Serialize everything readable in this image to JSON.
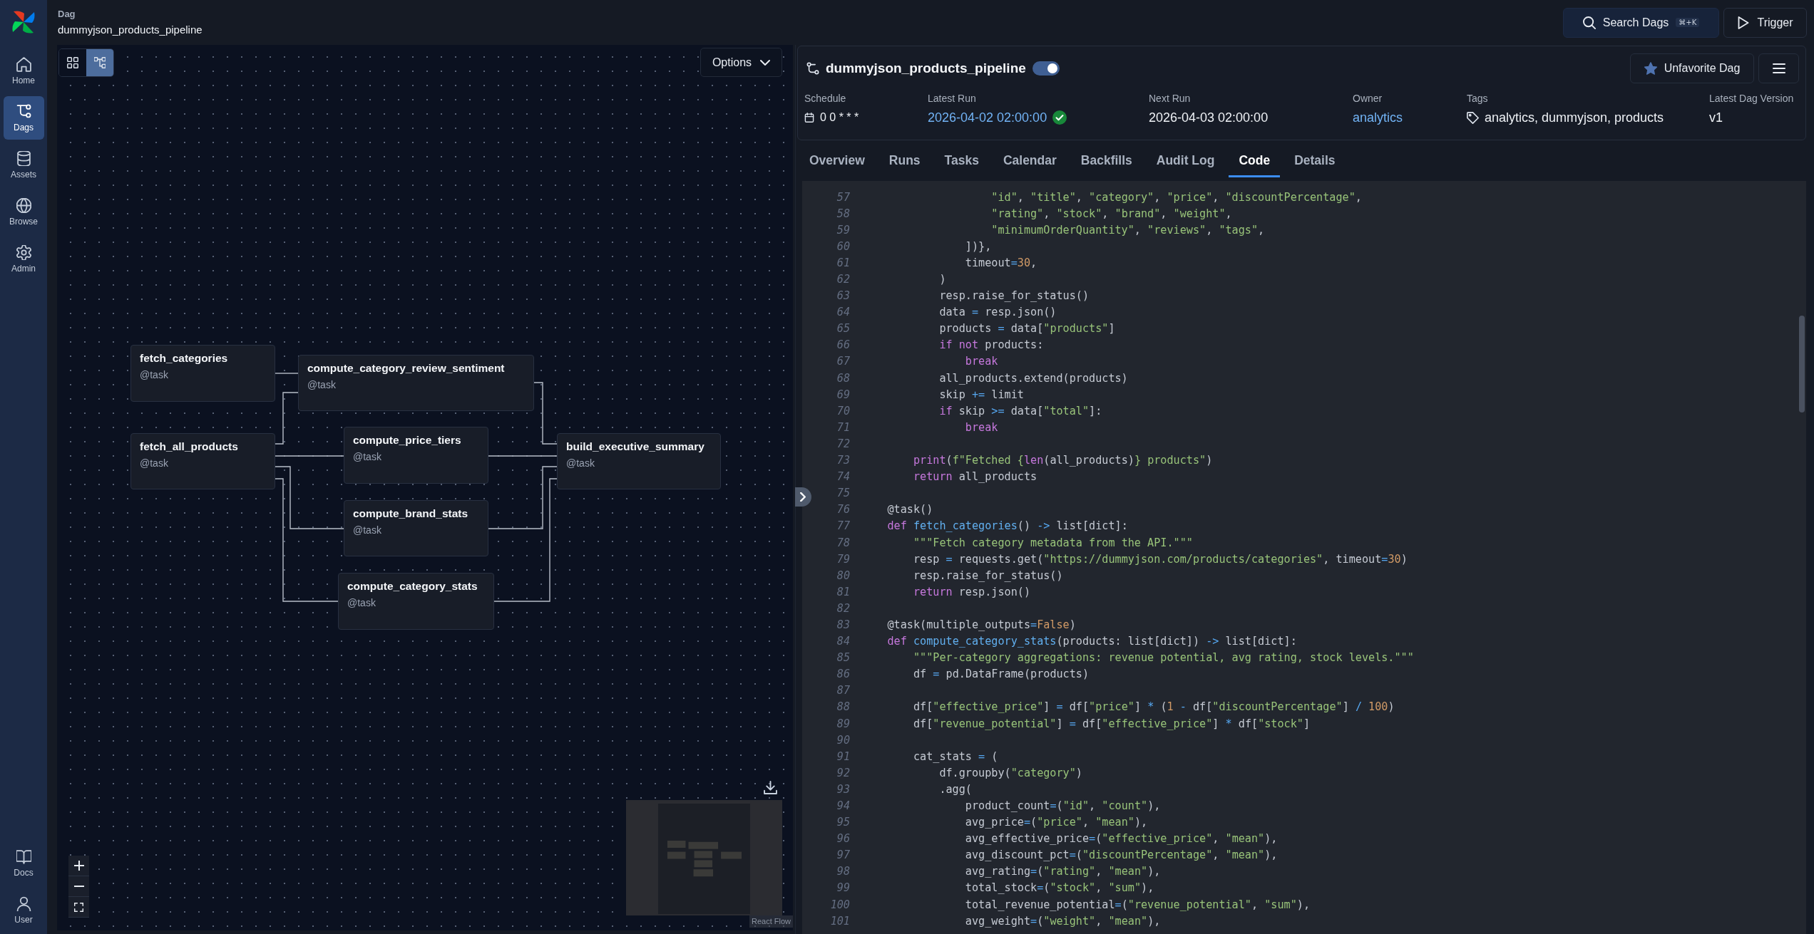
{
  "sidebar": {
    "items": [
      {
        "kind": "home",
        "label": "Home",
        "selected": false
      },
      {
        "kind": "dags",
        "label": "Dags",
        "selected": true
      },
      {
        "kind": "assets",
        "label": "Assets",
        "selected": false
      },
      {
        "kind": "browse",
        "label": "Browse",
        "selected": false
      },
      {
        "kind": "admin",
        "label": "Admin",
        "selected": false
      }
    ],
    "bottom_items": [
      {
        "kind": "docs",
        "label": "Docs",
        "selected": false
      },
      {
        "kind": "user",
        "label": "User",
        "selected": false
      }
    ]
  },
  "header": {
    "label": "Dag",
    "title": "dummyjson_products_pipeline",
    "search_button": {
      "label": "Search Dags",
      "shortcut": "⌘+K"
    },
    "trigger_button": "Trigger"
  },
  "graph": {
    "view_buttons": [
      {
        "kind": "grid",
        "selected": false
      },
      {
        "kind": "graph",
        "selected": true
      }
    ],
    "options_button": "Options",
    "nodes": [
      {
        "name": "fetch_categories",
        "type": "@task"
      },
      {
        "name": "compute_category_review_sentiment",
        "type": "@task"
      },
      {
        "name": "fetch_all_products",
        "type": "@task"
      },
      {
        "name": "compute_price_tiers",
        "type": "@task"
      },
      {
        "name": "build_executive_summary",
        "type": "@task"
      },
      {
        "name": "compute_brand_stats",
        "type": "@task"
      },
      {
        "name": "compute_category_stats",
        "type": "@task"
      }
    ],
    "attribution": "React Flow"
  },
  "dag": {
    "title": "dummyjson_products_pipeline",
    "active": true,
    "favorited": true,
    "favorite_button": "Unfavorite Dag",
    "details": [
      {
        "kind": "schedule",
        "label": "Schedule",
        "value": "0 0 * * *"
      },
      {
        "kind": "run",
        "label": "Latest Run",
        "value": "2026-04-02 02:00:00",
        "succeeded": true
      },
      {
        "kind": "text",
        "label": "Next Run",
        "value": "2026-04-03 02:00:00"
      },
      {
        "kind": "link",
        "label": "Owner",
        "value": "analytics"
      },
      {
        "kind": "tags",
        "label": "Tags",
        "value": "analytics, dummyjson, products"
      },
      {
        "kind": "text",
        "label": "Latest Dag Version",
        "value": "v1"
      }
    ]
  },
  "tabs": [
    {
      "label": "Overview",
      "selected": false
    },
    {
      "label": "Runs",
      "selected": false
    },
    {
      "label": "Tasks",
      "selected": false
    },
    {
      "label": "Calendar",
      "selected": false
    },
    {
      "label": "Backfills",
      "selected": false
    },
    {
      "label": "Audit Log",
      "selected": false
    },
    {
      "label": "Code",
      "selected": true
    },
    {
      "label": "Details",
      "selected": false
    }
  ],
  "code": {
    "lines": [
      {
        "number": "57",
        "tokens": [
          {
            "kind": "string",
            "text": "                    \"id\""
          },
          {
            "kind": "plain",
            "text": ", "
          },
          {
            "kind": "string",
            "text": "\"title\""
          },
          {
            "kind": "plain",
            "text": ", "
          },
          {
            "kind": "string",
            "text": "\"category\""
          },
          {
            "kind": "plain",
            "text": ", "
          },
          {
            "kind": "string",
            "text": "\"price\""
          },
          {
            "kind": "plain",
            "text": ", "
          },
          {
            "kind": "string",
            "text": "\"discountPercentage\""
          },
          {
            "kind": "plain",
            "text": ","
          }
        ]
      },
      {
        "number": "58",
        "tokens": [
          {
            "kind": "string",
            "text": "                    \"rating\""
          },
          {
            "kind": "plain",
            "text": ", "
          },
          {
            "kind": "string",
            "text": "\"stock\""
          },
          {
            "kind": "plain",
            "text": ", "
          },
          {
            "kind": "string",
            "text": "\"brand\""
          },
          {
            "kind": "plain",
            "text": ", "
          },
          {
            "kind": "string",
            "text": "\"weight\""
          },
          {
            "kind": "plain",
            "text": ","
          }
        ]
      },
      {
        "number": "59",
        "tokens": [
          {
            "kind": "string",
            "text": "                    \"minimumOrderQuantity\""
          },
          {
            "kind": "plain",
            "text": ", "
          },
          {
            "kind": "string",
            "text": "\"reviews\""
          },
          {
            "kind": "plain",
            "text": ", "
          },
          {
            "kind": "string",
            "text": "\"tags\""
          },
          {
            "kind": "plain",
            "text": ","
          }
        ]
      },
      {
        "number": "60",
        "tokens": [
          {
            "kind": "plain",
            "text": "                ])},"
          }
        ]
      },
      {
        "number": "61",
        "tokens": [
          {
            "kind": "plain",
            "text": "                timeout"
          },
          {
            "kind": "operator",
            "text": "="
          },
          {
            "kind": "number",
            "text": "30"
          },
          {
            "kind": "plain",
            "text": ","
          }
        ]
      },
      {
        "number": "62",
        "tokens": [
          {
            "kind": "plain",
            "text": "            )"
          }
        ]
      },
      {
        "number": "63",
        "tokens": [
          {
            "kind": "plain",
            "text": "            resp.raise_for_status()"
          }
        ]
      },
      {
        "number": "64",
        "tokens": [
          {
            "kind": "plain",
            "text": "            data "
          },
          {
            "kind": "operator",
            "text": "="
          },
          {
            "kind": "plain",
            "text": " resp.json()"
          }
        ]
      },
      {
        "number": "65",
        "tokens": [
          {
            "kind": "plain",
            "text": "            products "
          },
          {
            "kind": "operator",
            "text": "="
          },
          {
            "kind": "plain",
            "text": " data["
          },
          {
            "kind": "string",
            "text": "\"products\""
          },
          {
            "kind": "plain",
            "text": "]"
          }
        ]
      },
      {
        "number": "66",
        "tokens": [
          {
            "kind": "keyword",
            "text": "            if"
          },
          {
            "kind": "keyword",
            "text": " not"
          },
          {
            "kind": "plain",
            "text": " products:"
          }
        ]
      },
      {
        "number": "67",
        "tokens": [
          {
            "kind": "keyword",
            "text": "                break"
          }
        ]
      },
      {
        "number": "68",
        "tokens": [
          {
            "kind": "plain",
            "text": "            all_products.extend(products)"
          }
        ]
      },
      {
        "number": "69",
        "tokens": [
          {
            "kind": "plain",
            "text": "            skip "
          },
          {
            "kind": "operator",
            "text": "+="
          },
          {
            "kind": "plain",
            "text": " limit"
          }
        ]
      },
      {
        "number": "70",
        "tokens": [
          {
            "kind": "keyword",
            "text": "            if"
          },
          {
            "kind": "plain",
            "text": " skip "
          },
          {
            "kind": "operator",
            "text": ">="
          },
          {
            "kind": "plain",
            "text": " data["
          },
          {
            "kind": "string",
            "text": "\"total\""
          },
          {
            "kind": "plain",
            "text": "]:"
          }
        ]
      },
      {
        "number": "71",
        "tokens": [
          {
            "kind": "keyword",
            "text": "                break"
          }
        ]
      },
      {
        "number": "72"
      },
      {
        "number": "73",
        "tokens": [
          {
            "kind": "keyword",
            "text": "        print"
          },
          {
            "kind": "plain",
            "text": "("
          },
          {
            "kind": "string",
            "text": "f\"Fetched {"
          },
          {
            "kind": "keyword",
            "text": "len"
          },
          {
            "kind": "plain",
            "text": "(all_products)"
          },
          {
            "kind": "string",
            "text": "} products\""
          },
          {
            "kind": "plain",
            "text": ")"
          }
        ]
      },
      {
        "number": "74",
        "tokens": [
          {
            "kind": "keyword",
            "text": "        return"
          },
          {
            "kind": "plain",
            "text": " all_products"
          }
        ]
      },
      {
        "number": "75"
      },
      {
        "number": "76",
        "tokens": [
          {
            "kind": "plain",
            "text": "    @task()"
          }
        ]
      },
      {
        "number": "77",
        "tokens": [
          {
            "kind": "keyword",
            "text": "    def"
          },
          {
            "kind": "function",
            "text": " fetch_categories"
          },
          {
            "kind": "plain",
            "text": "() "
          },
          {
            "kind": "operator",
            "text": "->"
          },
          {
            "kind": "plain",
            "text": " list[dict]:"
          }
        ]
      },
      {
        "number": "78",
        "tokens": [
          {
            "kind": "string",
            "text": "        \"\"\"Fetch category metadata from the API.\"\"\""
          }
        ]
      },
      {
        "number": "79",
        "tokens": [
          {
            "kind": "plain",
            "text": "        resp "
          },
          {
            "kind": "operator",
            "text": "="
          },
          {
            "kind": "plain",
            "text": " requests.get("
          },
          {
            "kind": "string",
            "text": "\"https://dummyjson.com/products/categories\""
          },
          {
            "kind": "plain",
            "text": ", timeout"
          },
          {
            "kind": "operator",
            "text": "="
          },
          {
            "kind": "number",
            "text": "30"
          },
          {
            "kind": "plain",
            "text": ")"
          }
        ]
      },
      {
        "number": "80",
        "tokens": [
          {
            "kind": "plain",
            "text": "        resp.raise_for_status()"
          }
        ]
      },
      {
        "number": "81",
        "tokens": [
          {
            "kind": "keyword",
            "text": "        return"
          },
          {
            "kind": "plain",
            "text": " resp.json()"
          }
        ]
      },
      {
        "number": "82"
      },
      {
        "number": "83",
        "tokens": [
          {
            "kind": "plain",
            "text": "    @task(multiple_outputs"
          },
          {
            "kind": "operator",
            "text": "="
          },
          {
            "kind": "number",
            "text": "False"
          },
          {
            "kind": "plain",
            "text": ")"
          }
        ]
      },
      {
        "number": "84",
        "tokens": [
          {
            "kind": "keyword",
            "text": "    def"
          },
          {
            "kind": "function",
            "text": " compute_category_stats"
          },
          {
            "kind": "plain",
            "text": "(products: list[dict]) "
          },
          {
            "kind": "operator",
            "text": "->"
          },
          {
            "kind": "plain",
            "text": " list[dict]:"
          }
        ]
      },
      {
        "number": "85",
        "tokens": [
          {
            "kind": "string",
            "text": "        \"\"\"Per-category aggregations: revenue potential, avg rating, stock levels.\"\"\""
          }
        ]
      },
      {
        "number": "86",
        "tokens": [
          {
            "kind": "plain",
            "text": "        df "
          },
          {
            "kind": "operator",
            "text": "="
          },
          {
            "kind": "plain",
            "text": " pd.DataFrame(products)"
          }
        ]
      },
      {
        "number": "87"
      },
      {
        "number": "88",
        "tokens": [
          {
            "kind": "plain",
            "text": "        df["
          },
          {
            "kind": "string",
            "text": "\"effective_price\""
          },
          {
            "kind": "plain",
            "text": "] "
          },
          {
            "kind": "operator",
            "text": "="
          },
          {
            "kind": "plain",
            "text": " df["
          },
          {
            "kind": "string",
            "text": "\"price\""
          },
          {
            "kind": "plain",
            "text": "] "
          },
          {
            "kind": "operator",
            "text": "*"
          },
          {
            "kind": "plain",
            "text": " ("
          },
          {
            "kind": "number",
            "text": "1"
          },
          {
            "kind": "operator",
            "text": " -"
          },
          {
            "kind": "plain",
            "text": " df["
          },
          {
            "kind": "string",
            "text": "\"discountPercentage\""
          },
          {
            "kind": "plain",
            "text": "] "
          },
          {
            "kind": "operator",
            "text": "/"
          },
          {
            "kind": "number",
            "text": " 100"
          },
          {
            "kind": "plain",
            "text": ")"
          }
        ]
      },
      {
        "number": "89",
        "tokens": [
          {
            "kind": "plain",
            "text": "        df["
          },
          {
            "kind": "string",
            "text": "\"revenue_potential\""
          },
          {
            "kind": "plain",
            "text": "] "
          },
          {
            "kind": "operator",
            "text": "="
          },
          {
            "kind": "plain",
            "text": " df["
          },
          {
            "kind": "string",
            "text": "\"effective_price\""
          },
          {
            "kind": "plain",
            "text": "] "
          },
          {
            "kind": "operator",
            "text": "*"
          },
          {
            "kind": "plain",
            "text": " df["
          },
          {
            "kind": "string",
            "text": "\"stock\""
          },
          {
            "kind": "plain",
            "text": "]"
          }
        ]
      },
      {
        "number": "90"
      },
      {
        "number": "91",
        "tokens": [
          {
            "kind": "plain",
            "text": "        cat_stats "
          },
          {
            "kind": "operator",
            "text": "="
          },
          {
            "kind": "plain",
            "text": " ("
          }
        ]
      },
      {
        "number": "92",
        "tokens": [
          {
            "kind": "plain",
            "text": "            df.groupby("
          },
          {
            "kind": "string",
            "text": "\"category\""
          },
          {
            "kind": "plain",
            "text": ")"
          }
        ]
      },
      {
        "number": "93",
        "tokens": [
          {
            "kind": "plain",
            "text": "            .agg("
          }
        ]
      },
      {
        "number": "94",
        "tokens": [
          {
            "kind": "plain",
            "text": "                product_count"
          },
          {
            "kind": "operator",
            "text": "="
          },
          {
            "kind": "plain",
            "text": "("
          },
          {
            "kind": "string",
            "text": "\"id\""
          },
          {
            "kind": "plain",
            "text": ", "
          },
          {
            "kind": "string",
            "text": "\"count\""
          },
          {
            "kind": "plain",
            "text": "),"
          }
        ]
      },
      {
        "number": "95",
        "tokens": [
          {
            "kind": "plain",
            "text": "                avg_price"
          },
          {
            "kind": "operator",
            "text": "="
          },
          {
            "kind": "plain",
            "text": "("
          },
          {
            "kind": "string",
            "text": "\"price\""
          },
          {
            "kind": "plain",
            "text": ", "
          },
          {
            "kind": "string",
            "text": "\"mean\""
          },
          {
            "kind": "plain",
            "text": "),"
          }
        ]
      },
      {
        "number": "96",
        "tokens": [
          {
            "kind": "plain",
            "text": "                avg_effective_price"
          },
          {
            "kind": "operator",
            "text": "="
          },
          {
            "kind": "plain",
            "text": "("
          },
          {
            "kind": "string",
            "text": "\"effective_price\""
          },
          {
            "kind": "plain",
            "text": ", "
          },
          {
            "kind": "string",
            "text": "\"mean\""
          },
          {
            "kind": "plain",
            "text": "),"
          }
        ]
      },
      {
        "number": "97",
        "tokens": [
          {
            "kind": "plain",
            "text": "                avg_discount_pct"
          },
          {
            "kind": "operator",
            "text": "="
          },
          {
            "kind": "plain",
            "text": "("
          },
          {
            "kind": "string",
            "text": "\"discountPercentage\""
          },
          {
            "kind": "plain",
            "text": ", "
          },
          {
            "kind": "string",
            "text": "\"mean\""
          },
          {
            "kind": "plain",
            "text": "),"
          }
        ]
      },
      {
        "number": "98",
        "tokens": [
          {
            "kind": "plain",
            "text": "                avg_rating"
          },
          {
            "kind": "operator",
            "text": "="
          },
          {
            "kind": "plain",
            "text": "("
          },
          {
            "kind": "string",
            "text": "\"rating\""
          },
          {
            "kind": "plain",
            "text": ", "
          },
          {
            "kind": "string",
            "text": "\"mean\""
          },
          {
            "kind": "plain",
            "text": "),"
          }
        ]
      },
      {
        "number": "99",
        "tokens": [
          {
            "kind": "plain",
            "text": "                total_stock"
          },
          {
            "kind": "operator",
            "text": "="
          },
          {
            "kind": "plain",
            "text": "("
          },
          {
            "kind": "string",
            "text": "\"stock\""
          },
          {
            "kind": "plain",
            "text": ", "
          },
          {
            "kind": "string",
            "text": "\"sum\""
          },
          {
            "kind": "plain",
            "text": "),"
          }
        ]
      },
      {
        "number": "100",
        "tokens": [
          {
            "kind": "plain",
            "text": "                total_revenue_potential"
          },
          {
            "kind": "operator",
            "text": "="
          },
          {
            "kind": "plain",
            "text": "("
          },
          {
            "kind": "string",
            "text": "\"revenue_potential\""
          },
          {
            "kind": "plain",
            "text": ", "
          },
          {
            "kind": "string",
            "text": "\"sum\""
          },
          {
            "kind": "plain",
            "text": "),"
          }
        ]
      },
      {
        "number": "101",
        "tokens": [
          {
            "kind": "plain",
            "text": "                avg_weight"
          },
          {
            "kind": "operator",
            "text": "="
          },
          {
            "kind": "plain",
            "text": "("
          },
          {
            "kind": "string",
            "text": "\"weight\""
          },
          {
            "kind": "plain",
            "text": ", "
          },
          {
            "kind": "string",
            "text": "\"mean\""
          },
          {
            "kind": "plain",
            "text": "),"
          }
        ]
      }
    ]
  }
}
